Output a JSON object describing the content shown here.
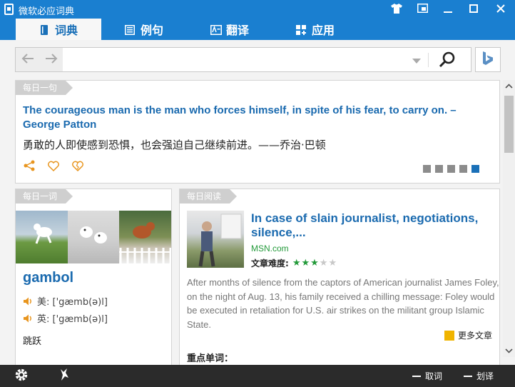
{
  "app": {
    "title": "微软必应词典"
  },
  "tabs": [
    {
      "label": "词典"
    },
    {
      "label": "例句"
    },
    {
      "label": "翻译"
    },
    {
      "label": "应用"
    }
  ],
  "search": {
    "value": "",
    "placeholder": ""
  },
  "daily_sentence": {
    "tag": "每日一句",
    "english": "The courageous man is the man who forces himself, in spite of his fear, to carry on. – George Patton",
    "chinese": "勇敢的人即使感到恐惧，也会强迫自己继续前进。——乔治·巴顿",
    "page_count": 5,
    "active_page": 5
  },
  "daily_word": {
    "tag": "每日一词",
    "word": "gambol",
    "us_label": "美: ['gæmb(ə)l]",
    "uk_label": "英: ['gæmb(ə)l]",
    "meaning": "跳跃"
  },
  "daily_reading": {
    "tag": "每日阅读",
    "title": "In case of slain journalist, negotiations, silence,...",
    "source": "MSN.com",
    "difficulty_label": "文章难度:",
    "difficulty": 3,
    "difficulty_max": 5,
    "body": "After months of silence from the captors of American journalist James Foley, on the night of Aug. 13, his family received a chilling message: Foley would be executed in retaliation for U.S. air strikes on the militant group Islamic State.",
    "more_label": "更多文章",
    "keywords_label": "重点单词："
  },
  "bottom": {
    "words_label": "取词",
    "translate_label": "划译"
  },
  "colors": {
    "accent": "#1a7fd0",
    "link": "#1a6aaf",
    "icon_orange": "#e8951e",
    "star_green": "#239a3a"
  }
}
